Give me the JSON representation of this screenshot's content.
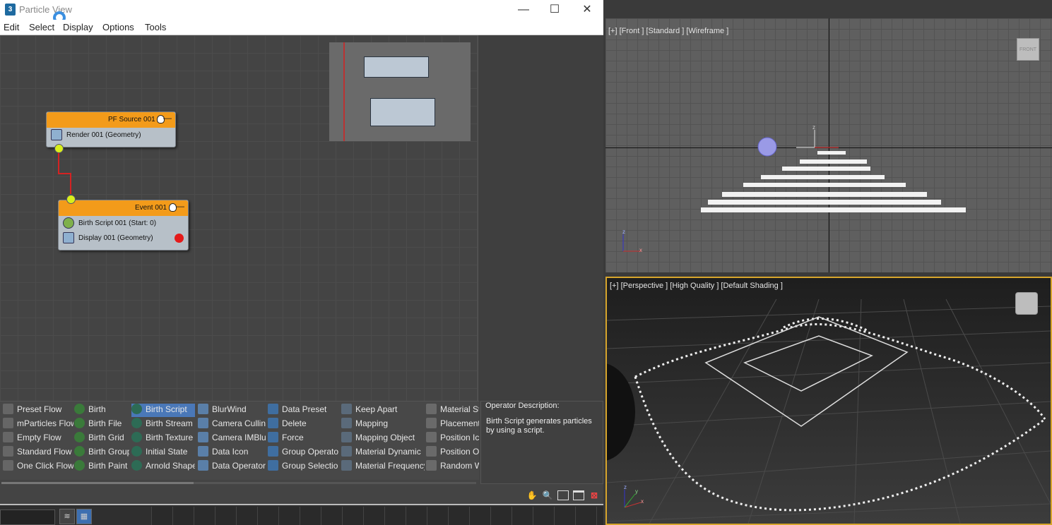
{
  "window": {
    "icon_text": "3",
    "title": "Particle View",
    "minimize": "—",
    "maximize": "☐",
    "close": "✕"
  },
  "menu": [
    "Edit",
    "Select",
    "Display",
    "Options",
    "Tools"
  ],
  "nodes": {
    "source": {
      "title": "PF Source 001",
      "minimize": "—",
      "rows": [
        "Render 001 (Geometry)"
      ]
    },
    "event": {
      "title": "Event 001",
      "minimize": "—",
      "rows": [
        "Birth Script 001 (Start: 0)",
        "Display 001 (Geometry)"
      ]
    }
  },
  "depot": {
    "columns": [
      [
        "Preset Flow",
        "mParticles Flow",
        "Empty Flow",
        "Standard Flow",
        "One Click Flow"
      ],
      [
        "Birth",
        "Birth File",
        "Birth Grid",
        "Birth Group",
        "Birth Paint"
      ],
      [
        "Birth Script",
        "Birth Stream",
        "Birth Texture",
        "Initial State",
        "Arnold Shape"
      ],
      [
        "BlurWind",
        "Camera Culling",
        "Camera IMBlur",
        "Data Icon",
        "Data Operator"
      ],
      [
        "Data Preset",
        "Delete",
        "Force",
        "Group Operator",
        "Group Selection"
      ],
      [
        "Keep Apart",
        "Mapping",
        "Mapping Object",
        "Material Dynamic",
        "Material Frequency"
      ],
      [
        "Material Sta",
        "Placement P",
        "Position Ico",
        "Position Obj",
        "Random Wa"
      ]
    ],
    "selected": "Birth Script"
  },
  "description": {
    "title": "Operator Description:",
    "text": "Birth Script generates particles by using a script."
  },
  "bottom_tools": [
    "hand-icon",
    "zoom-icon",
    "zoom-region-icon",
    "zoom-extents-icon",
    "no-icon"
  ],
  "viewports": {
    "front": {
      "label": "[+] [Front ] [Standard ] [Wireframe ]",
      "cube_label": "FRONT",
      "axis_z": "z",
      "axis_x": "x",
      "axis_top_z": "z"
    },
    "perspective": {
      "label": "[+] [Perspective ] [High Quality ] [Default Shading ]",
      "axis_z": "z",
      "axis_x": "x",
      "axis_y": "y"
    }
  },
  "colors": {
    "node_header": "#f39b1a",
    "wire": "#d42222",
    "port": "#d9ef1b",
    "active_viewport_border": "#d7a52c",
    "selected_item": "#4a78b8"
  }
}
